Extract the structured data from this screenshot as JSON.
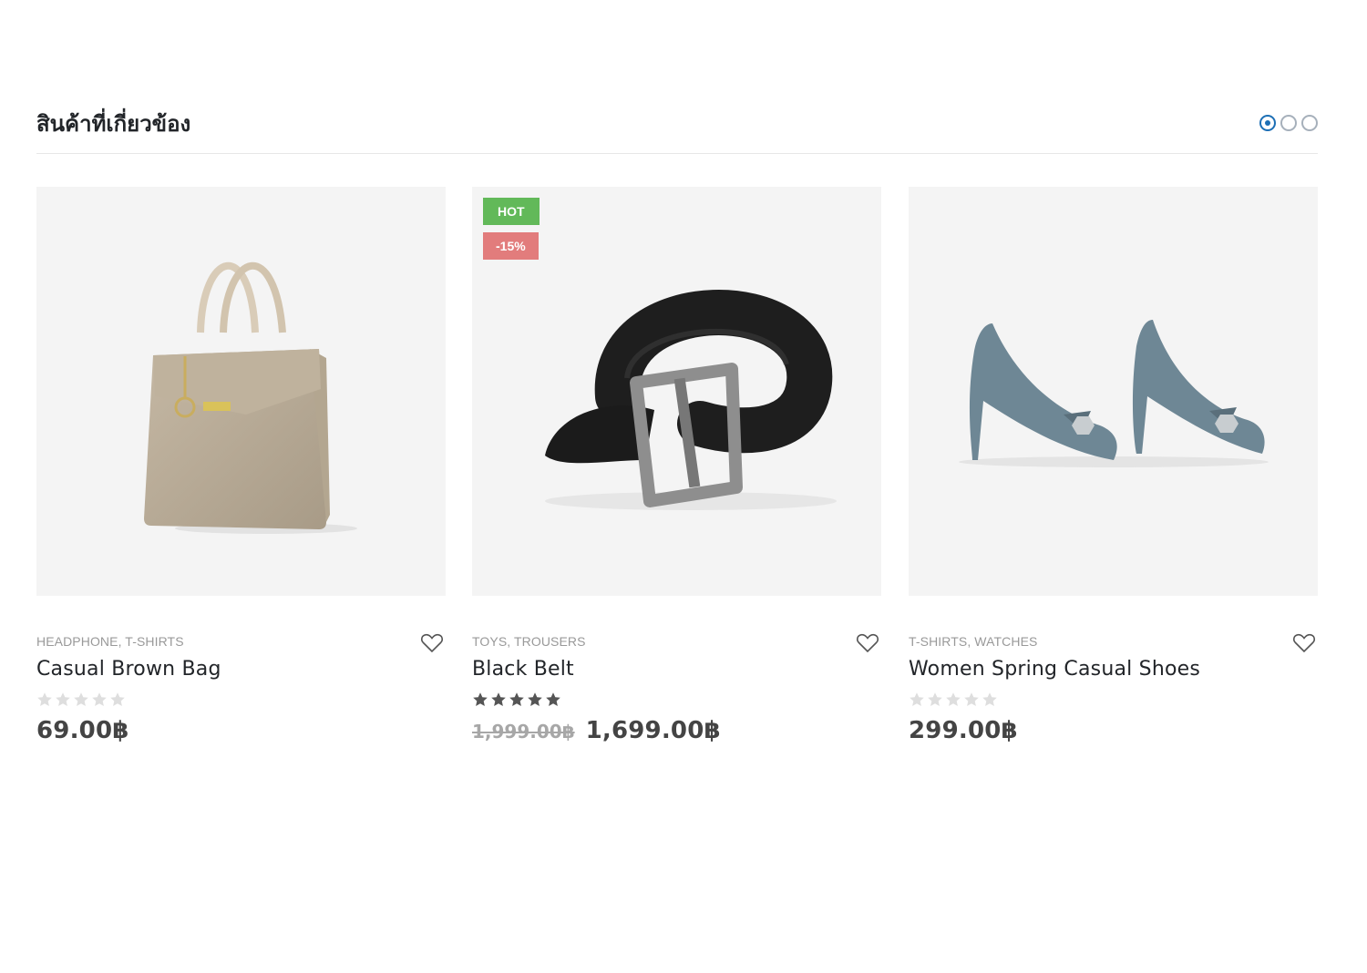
{
  "section": {
    "title": "สินค้าที่เกี่ยวข้อง",
    "pagination": {
      "count": 3,
      "active": 1
    }
  },
  "colors": {
    "accent": "#1d6fb5",
    "hot_badge": "#62b959",
    "sale_badge": "#e27c7c",
    "image_bg": "#f4f4f4"
  },
  "products": [
    {
      "image_icon": "handbag-image",
      "categories": "HEADPHONE, T-SHIRTS",
      "name": "Casual Brown Bag",
      "rating": 0,
      "price": "69.00฿",
      "old_price": "",
      "badges": []
    },
    {
      "image_icon": "belt-image",
      "categories": "TOYS, TROUSERS",
      "name": "Black Belt",
      "rating": 5,
      "price": "1,699.00฿",
      "old_price": "1,999.00฿",
      "badges": [
        "HOT",
        "-15%"
      ]
    },
    {
      "image_icon": "high-heels-image",
      "categories": "T-SHIRTS, WATCHES",
      "name": "Women Spring Casual Shoes",
      "rating": 0,
      "price": "299.00฿",
      "old_price": "",
      "badges": []
    }
  ]
}
